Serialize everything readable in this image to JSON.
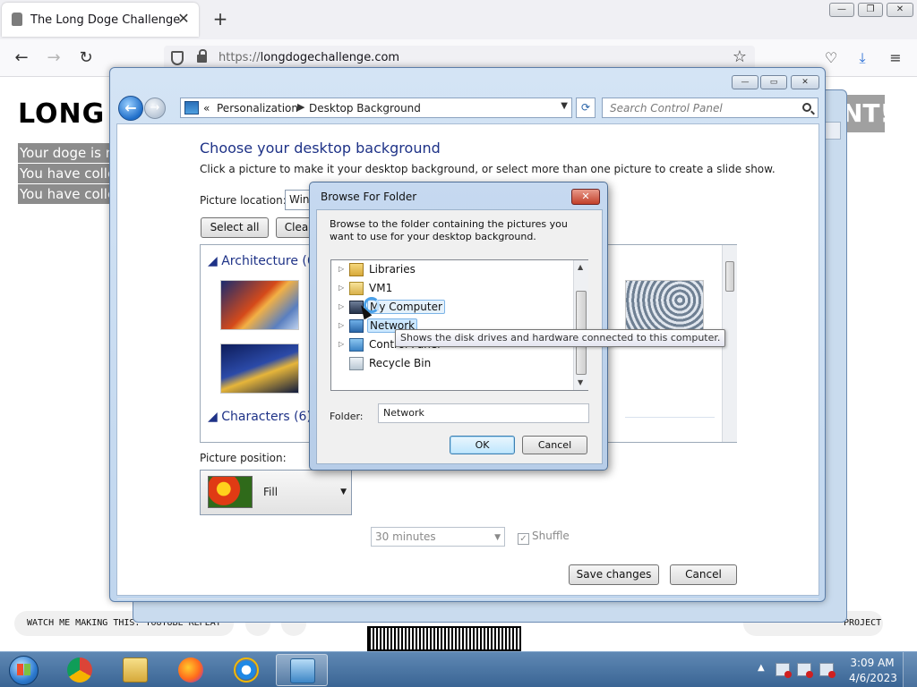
{
  "browser": {
    "tab_title": "The Long Doge Challenge",
    "tab_close": "✕",
    "new_tab": "+",
    "url_scheme": "https://",
    "url_host": "longdogechallenge.com",
    "back": "←",
    "forward": "→",
    "reload": "↻",
    "star": "☆",
    "menu": "≡",
    "window_controls": {
      "minimize": "—",
      "restore": "❐",
      "close": "✕"
    }
  },
  "webpage": {
    "heading_left": "LONG",
    "heading_right": "NT!",
    "lines": [
      "Your doge is r",
      "You have colle",
      "You have colle"
    ],
    "footer_left": "WATCH ME MAKING THIS: YOUTUBE REPLAY",
    "footer_right": "PROJECT"
  },
  "control_panel": {
    "breadcrumb_prefix": "«",
    "breadcrumb": [
      "Personalization",
      "Desktop Background"
    ],
    "search_placeholder": "Search Control Panel",
    "title": "Choose your desktop background",
    "subtitle": "Click a picture to make it your desktop background, or select more than one picture to create a slide show.",
    "picture_location_label": "Picture location:",
    "picture_location_value": "Wind",
    "select_all": "Select all",
    "clear_all": "Clea",
    "groups": [
      {
        "name": "Architecture (6)"
      },
      {
        "name": "Characters (6)"
      }
    ],
    "picture_position_label": "Picture position:",
    "picture_position_value": "Fill",
    "interval_value": "30 minutes",
    "shuffle_label": "Shuffle",
    "save_changes": "Save changes",
    "cancel": "Cancel",
    "caption_buttons": {
      "minimize": "—",
      "maximize": "▭",
      "close": "✕"
    }
  },
  "dialog": {
    "title": "Browse For Folder",
    "close": "✕",
    "description": "Browse to the folder containing the pictures you want to use for your desktop background.",
    "tree": [
      {
        "label": "Libraries",
        "icon": "libraries-icon",
        "expandable": true
      },
      {
        "label": "VM1",
        "icon": "user-folder-icon",
        "expandable": true
      },
      {
        "label": "My Computer",
        "icon": "computer-icon",
        "expandable": true,
        "hover": true
      },
      {
        "label": "Network",
        "icon": "network-icon",
        "expandable": true,
        "selected": true
      },
      {
        "label": "Control Panel",
        "icon": "control-panel-icon",
        "expandable": true
      },
      {
        "label": "Recycle Bin",
        "icon": "recycle-bin-icon",
        "expandable": false
      }
    ],
    "tooltip": "Shows the disk drives and hardware connected to this computer.",
    "folder_label": "Folder:",
    "folder_value": "Network",
    "ok": "OK",
    "cancel": "Cancel"
  },
  "taskbar": {
    "apps": [
      "chrome-icon",
      "explorer-icon",
      "firefox-icon",
      "internet-explorer-icon",
      "control-panel-icon"
    ],
    "tray_arrow": "▲",
    "time": "3:09 AM",
    "date": "4/6/2023"
  },
  "colors": {
    "link_blue": "#1e3287",
    "taskbar_top": "#5f88b4",
    "taskbar_bottom": "#3a6594",
    "window_frame": "#c0d6ee"
  }
}
